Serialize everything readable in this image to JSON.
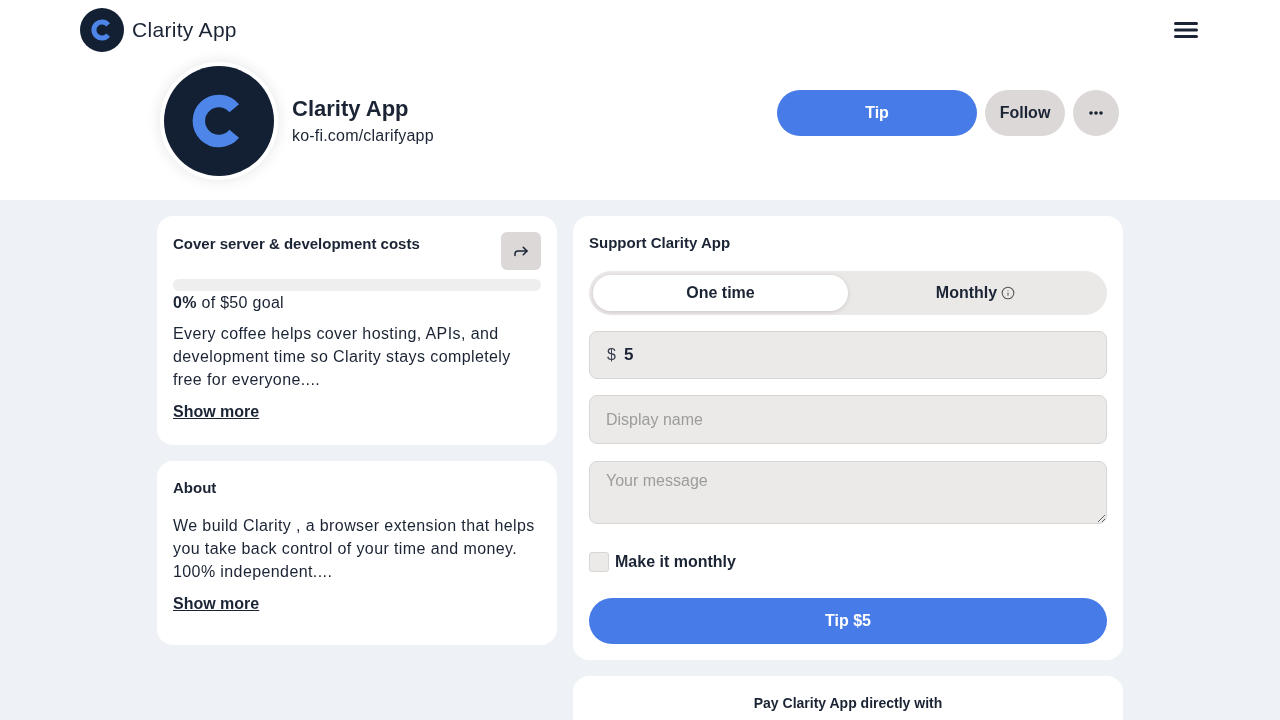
{
  "header": {
    "brand": "Clarity App"
  },
  "profile": {
    "name": "Clarity App",
    "url": "ko-fi.com/clarifyapp",
    "actions": [
      {
        "kind": "primary",
        "label": "Tip"
      },
      {
        "kind": "secondary",
        "label": "Follow"
      },
      {
        "kind": "more"
      }
    ]
  },
  "goal": {
    "title": "Cover server & development costs",
    "level": 0,
    "progress_text": "**0%** of $50 goal",
    "description": "Every coffee helps cover hosting, APIs, and development time so Clarity stays completely free for everyone....",
    "link": "Show more"
  },
  "about": {
    "title": "About",
    "description": "We build Clarity , a browser extension that helps you take back control of your time and money. 100% independent....",
    "link": "Show more"
  },
  "support": {
    "title": "Support Clarity App",
    "frequency_tabs": [
      {
        "label": "One time",
        "selected": true,
        "info": false
      },
      {
        "label": "Monthly",
        "selected": false,
        "info": true
      }
    ],
    "amount": {
      "prefix": "$",
      "value": "5"
    },
    "display_name": {
      "placeholder": "Display name"
    },
    "message": {
      "placeholder": "Your message"
    },
    "monthly_checkbox": {
      "label": "Make it monthly",
      "checked": false
    },
    "submit": "Tip $5"
  },
  "payment": {
    "title": "Pay Clarity App directly with"
  }
}
